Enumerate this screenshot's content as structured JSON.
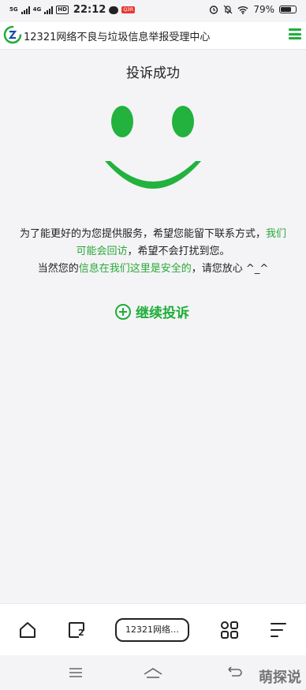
{
  "status_bar": {
    "network_1": "5G",
    "network_2": "4G",
    "hd": "HD",
    "time": "22:12",
    "app_badge": "Q3R",
    "battery": "79%"
  },
  "header": {
    "site_title": "12321网络不良与垃圾信息举报受理中心"
  },
  "main": {
    "title": "投诉成功",
    "message": {
      "line1_a": "为了能更好的为您提供服务，希望您能留下联系方式，",
      "line1_b": "我们",
      "line2_a": "可能会回访",
      "line2_b": "，希望不会打扰到您。",
      "line3_a": "当然您的",
      "line3_b": "信息在我们这里是安全的",
      "line3_c": "，请您放心 ^_^"
    },
    "continue_label": "继续投诉"
  },
  "toolbar": {
    "address": "12321网络…",
    "tab_count": "2"
  },
  "watermark": "萌探说",
  "colors": {
    "accent": "#1fae3a",
    "smiley": "#22b23d",
    "link_text": "#2aa83a"
  }
}
